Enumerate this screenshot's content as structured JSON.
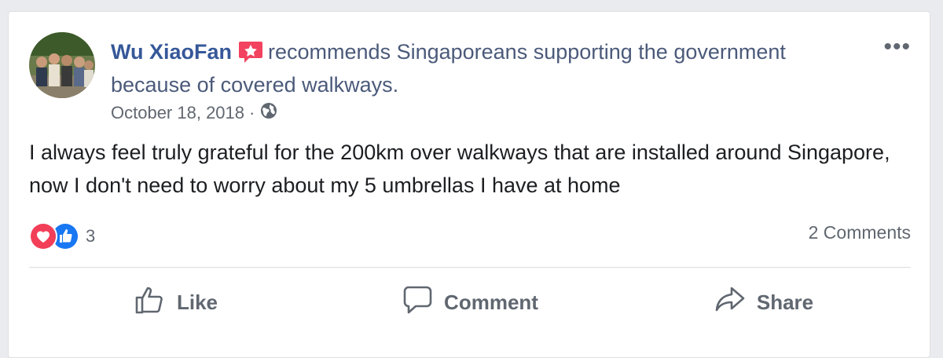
{
  "post": {
    "author": "Wu XiaoFan",
    "recommendation_text": "recommends Singaporeans supporting the government because of covered walkways.",
    "date": "October 18, 2018",
    "date_separator": "·",
    "more_label": "•••",
    "body": "I always feel truly grateful for the 200km over walkways that are installed around Singapore, now I don't need to worry about my 5 umbrellas I have at home",
    "reaction_count": "3",
    "comments_count": "2 Comments"
  },
  "actions": {
    "like": "Like",
    "comment": "Comment",
    "share": "Share"
  },
  "colors": {
    "link": "#365899",
    "badge": "#f3425f",
    "love": "#f33e58",
    "like_blue": "#1877f2"
  },
  "icons": [
    "recommend-badge-icon",
    "globe-icon",
    "love-reaction-icon",
    "like-reaction-icon",
    "thumbs-up-icon",
    "comment-bubble-icon",
    "share-arrow-icon",
    "more-options-icon"
  ]
}
